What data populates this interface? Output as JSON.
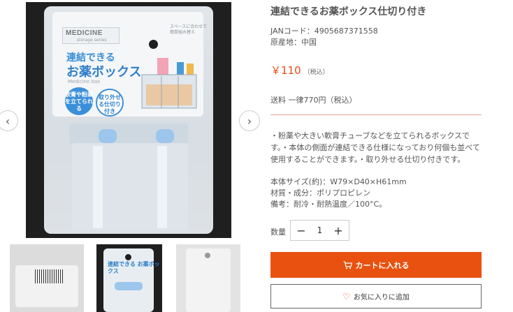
{
  "product": {
    "title": "連結できるお薬ボックス仕切り付き",
    "jan": "JANコード：4905687371558",
    "origin": "原産地：中国",
    "price": "￥110",
    "price_tax": "（税込）",
    "shipping": "送料 一律770円（税込）",
    "description": "・粉薬や大きい軟膏チューブなどを立てられるボックスです。・本体の側面が連結できる仕様になっており何個も並べて使用することができます。・取り外せる仕切り付きです。",
    "spec_size": "本体サイズ(約)：W79×D40×H61mm",
    "spec_material": "材質・成分：ポリプロピレン",
    "spec_note": "備考：耐冷・耐熱温度／100°C。"
  },
  "quantity": {
    "label": "数量",
    "value": "1",
    "minus": "−",
    "plus": "+"
  },
  "buttons": {
    "cart": "カートに入れる",
    "favorite": "お気に入りに追加"
  },
  "gallery": {
    "prev": "‹",
    "next": "›",
    "package": {
      "brand": "MEDICINE",
      "brand_sub": "storage series",
      "title_line1": "連結できる",
      "title_line2": "お薬ボックス",
      "title_en": "Medicine box",
      "badge_a": "軟膏や粉薬を立てられる",
      "badge_b": "取り外せる仕切り付き",
      "note": "スペースに合わせて簡単組み替え"
    },
    "thumb2_title": "連結できる お薬ボックス"
  },
  "colors": {
    "accent": "#e8510f",
    "price": "#e64b16",
    "brand_blue": "#2f7fc9"
  }
}
